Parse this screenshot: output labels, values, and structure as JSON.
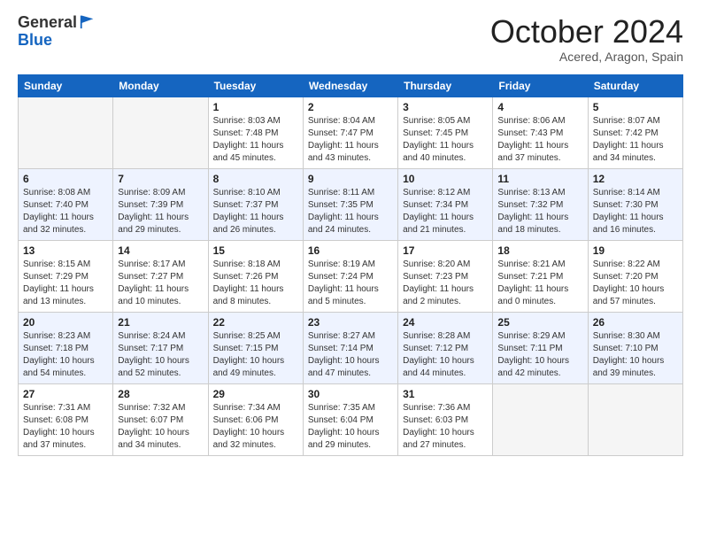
{
  "header": {
    "logo_general": "General",
    "logo_blue": "Blue",
    "month_title": "October 2024",
    "location": "Acered, Aragon, Spain"
  },
  "weekdays": [
    "Sunday",
    "Monday",
    "Tuesday",
    "Wednesday",
    "Thursday",
    "Friday",
    "Saturday"
  ],
  "rows": [
    [
      {
        "day": "",
        "sunrise": "",
        "sunset": "",
        "daylight": ""
      },
      {
        "day": "",
        "sunrise": "",
        "sunset": "",
        "daylight": ""
      },
      {
        "day": "1",
        "sunrise": "Sunrise: 8:03 AM",
        "sunset": "Sunset: 7:48 PM",
        "daylight": "Daylight: 11 hours and 45 minutes."
      },
      {
        "day": "2",
        "sunrise": "Sunrise: 8:04 AM",
        "sunset": "Sunset: 7:47 PM",
        "daylight": "Daylight: 11 hours and 43 minutes."
      },
      {
        "day": "3",
        "sunrise": "Sunrise: 8:05 AM",
        "sunset": "Sunset: 7:45 PM",
        "daylight": "Daylight: 11 hours and 40 minutes."
      },
      {
        "day": "4",
        "sunrise": "Sunrise: 8:06 AM",
        "sunset": "Sunset: 7:43 PM",
        "daylight": "Daylight: 11 hours and 37 minutes."
      },
      {
        "day": "5",
        "sunrise": "Sunrise: 8:07 AM",
        "sunset": "Sunset: 7:42 PM",
        "daylight": "Daylight: 11 hours and 34 minutes."
      }
    ],
    [
      {
        "day": "6",
        "sunrise": "Sunrise: 8:08 AM",
        "sunset": "Sunset: 7:40 PM",
        "daylight": "Daylight: 11 hours and 32 minutes."
      },
      {
        "day": "7",
        "sunrise": "Sunrise: 8:09 AM",
        "sunset": "Sunset: 7:39 PM",
        "daylight": "Daylight: 11 hours and 29 minutes."
      },
      {
        "day": "8",
        "sunrise": "Sunrise: 8:10 AM",
        "sunset": "Sunset: 7:37 PM",
        "daylight": "Daylight: 11 hours and 26 minutes."
      },
      {
        "day": "9",
        "sunrise": "Sunrise: 8:11 AM",
        "sunset": "Sunset: 7:35 PM",
        "daylight": "Daylight: 11 hours and 24 minutes."
      },
      {
        "day": "10",
        "sunrise": "Sunrise: 8:12 AM",
        "sunset": "Sunset: 7:34 PM",
        "daylight": "Daylight: 11 hours and 21 minutes."
      },
      {
        "day": "11",
        "sunrise": "Sunrise: 8:13 AM",
        "sunset": "Sunset: 7:32 PM",
        "daylight": "Daylight: 11 hours and 18 minutes."
      },
      {
        "day": "12",
        "sunrise": "Sunrise: 8:14 AM",
        "sunset": "Sunset: 7:30 PM",
        "daylight": "Daylight: 11 hours and 16 minutes."
      }
    ],
    [
      {
        "day": "13",
        "sunrise": "Sunrise: 8:15 AM",
        "sunset": "Sunset: 7:29 PM",
        "daylight": "Daylight: 11 hours and 13 minutes."
      },
      {
        "day": "14",
        "sunrise": "Sunrise: 8:17 AM",
        "sunset": "Sunset: 7:27 PM",
        "daylight": "Daylight: 11 hours and 10 minutes."
      },
      {
        "day": "15",
        "sunrise": "Sunrise: 8:18 AM",
        "sunset": "Sunset: 7:26 PM",
        "daylight": "Daylight: 11 hours and 8 minutes."
      },
      {
        "day": "16",
        "sunrise": "Sunrise: 8:19 AM",
        "sunset": "Sunset: 7:24 PM",
        "daylight": "Daylight: 11 hours and 5 minutes."
      },
      {
        "day": "17",
        "sunrise": "Sunrise: 8:20 AM",
        "sunset": "Sunset: 7:23 PM",
        "daylight": "Daylight: 11 hours and 2 minutes."
      },
      {
        "day": "18",
        "sunrise": "Sunrise: 8:21 AM",
        "sunset": "Sunset: 7:21 PM",
        "daylight": "Daylight: 11 hours and 0 minutes."
      },
      {
        "day": "19",
        "sunrise": "Sunrise: 8:22 AM",
        "sunset": "Sunset: 7:20 PM",
        "daylight": "Daylight: 10 hours and 57 minutes."
      }
    ],
    [
      {
        "day": "20",
        "sunrise": "Sunrise: 8:23 AM",
        "sunset": "Sunset: 7:18 PM",
        "daylight": "Daylight: 10 hours and 54 minutes."
      },
      {
        "day": "21",
        "sunrise": "Sunrise: 8:24 AM",
        "sunset": "Sunset: 7:17 PM",
        "daylight": "Daylight: 10 hours and 52 minutes."
      },
      {
        "day": "22",
        "sunrise": "Sunrise: 8:25 AM",
        "sunset": "Sunset: 7:15 PM",
        "daylight": "Daylight: 10 hours and 49 minutes."
      },
      {
        "day": "23",
        "sunrise": "Sunrise: 8:27 AM",
        "sunset": "Sunset: 7:14 PM",
        "daylight": "Daylight: 10 hours and 47 minutes."
      },
      {
        "day": "24",
        "sunrise": "Sunrise: 8:28 AM",
        "sunset": "Sunset: 7:12 PM",
        "daylight": "Daylight: 10 hours and 44 minutes."
      },
      {
        "day": "25",
        "sunrise": "Sunrise: 8:29 AM",
        "sunset": "Sunset: 7:11 PM",
        "daylight": "Daylight: 10 hours and 42 minutes."
      },
      {
        "day": "26",
        "sunrise": "Sunrise: 8:30 AM",
        "sunset": "Sunset: 7:10 PM",
        "daylight": "Daylight: 10 hours and 39 minutes."
      }
    ],
    [
      {
        "day": "27",
        "sunrise": "Sunrise: 7:31 AM",
        "sunset": "Sunset: 6:08 PM",
        "daylight": "Daylight: 10 hours and 37 minutes."
      },
      {
        "day": "28",
        "sunrise": "Sunrise: 7:32 AM",
        "sunset": "Sunset: 6:07 PM",
        "daylight": "Daylight: 10 hours and 34 minutes."
      },
      {
        "day": "29",
        "sunrise": "Sunrise: 7:34 AM",
        "sunset": "Sunset: 6:06 PM",
        "daylight": "Daylight: 10 hours and 32 minutes."
      },
      {
        "day": "30",
        "sunrise": "Sunrise: 7:35 AM",
        "sunset": "Sunset: 6:04 PM",
        "daylight": "Daylight: 10 hours and 29 minutes."
      },
      {
        "day": "31",
        "sunrise": "Sunrise: 7:36 AM",
        "sunset": "Sunset: 6:03 PM",
        "daylight": "Daylight: 10 hours and 27 minutes."
      },
      {
        "day": "",
        "sunrise": "",
        "sunset": "",
        "daylight": ""
      },
      {
        "day": "",
        "sunrise": "",
        "sunset": "",
        "daylight": ""
      }
    ]
  ]
}
